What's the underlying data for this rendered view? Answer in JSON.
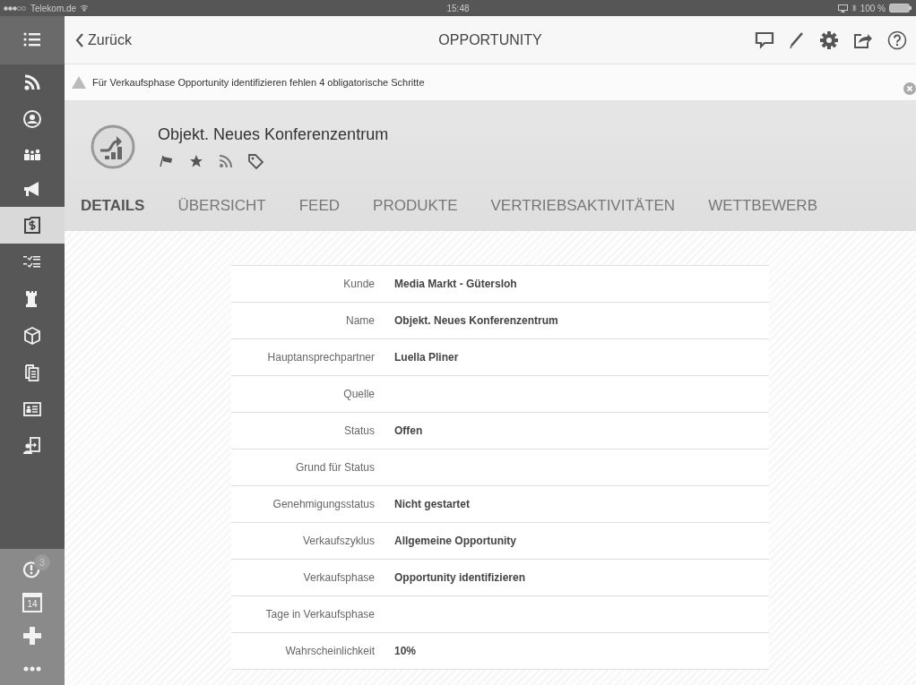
{
  "status_bar": {
    "carrier": "Telekom.de",
    "time": "15:48",
    "battery": "100 %"
  },
  "sidebar": {
    "top_items": [
      {
        "selected": false
      },
      {
        "selected": false
      },
      {
        "selected": false
      },
      {
        "selected": false
      },
      {
        "selected": false
      },
      {
        "selected": true
      },
      {
        "selected": false
      },
      {
        "selected": false
      },
      {
        "selected": false
      },
      {
        "selected": false
      },
      {
        "selected": false
      },
      {
        "selected": false
      }
    ],
    "bottom_items": [
      {
        "selected": false,
        "badge": "3"
      },
      {
        "selected": false,
        "label": "14"
      },
      {
        "selected": false
      },
      {
        "selected": false
      }
    ]
  },
  "nav_bar": {
    "back": "Zurück",
    "title": "OPPORTUNITY"
  },
  "warning": {
    "text": "Für Verkaufsphase Opportunity identifizieren fehlen 4 obligatorische Schritte"
  },
  "record": {
    "title": "Objekt. Neues Konferenzentrum"
  },
  "tabs": [
    {
      "label": "DETAILS",
      "selected": true
    },
    {
      "label": "ÜBERSICHT",
      "selected": false
    },
    {
      "label": "FEED",
      "selected": false
    },
    {
      "label": "PRODUKTE",
      "selected": false
    },
    {
      "label": "VERTRIEBSAKTIVITÄTEN",
      "selected": false
    },
    {
      "label": "WETTBEWERB",
      "selected": false
    }
  ],
  "fields": [
    {
      "label": "Kunde",
      "value": "Media Markt - Gütersloh"
    },
    {
      "label": "Name",
      "value": "Objekt. Neues Konferenzentrum"
    },
    {
      "label": "Hauptansprechpartner",
      "value": "Luella Pliner"
    },
    {
      "label": "Quelle"
    },
    {
      "label": "Status",
      "value": "Offen"
    },
    {
      "label": "Grund für Status"
    },
    {
      "label": "Genehmigungsstatus",
      "value": "Nicht gestartet"
    },
    {
      "label": "Verkaufszyklus",
      "value": "Allgemeine Opportunity"
    },
    {
      "label": "Verkaufsphase",
      "value": "Opportunity identifizieren"
    },
    {
      "label": "Tage in Verkaufsphase"
    },
    {
      "label": "Wahrscheinlichkeit",
      "value": "10%"
    }
  ]
}
